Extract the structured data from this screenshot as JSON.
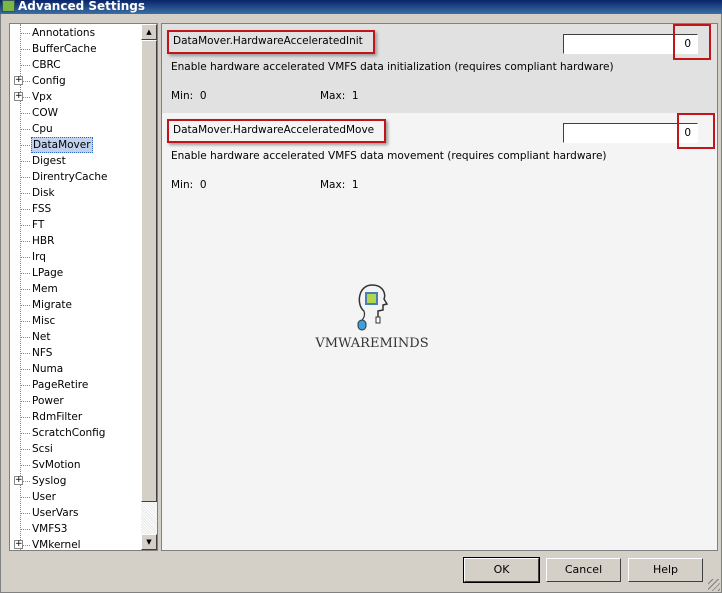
{
  "window": {
    "title": "Advanced Settings"
  },
  "tree": {
    "items": [
      {
        "label": "Annotations",
        "expandable": false
      },
      {
        "label": "BufferCache",
        "expandable": false
      },
      {
        "label": "CBRC",
        "expandable": false
      },
      {
        "label": "Config",
        "expandable": true
      },
      {
        "label": "Vpx",
        "expandable": true
      },
      {
        "label": "COW",
        "expandable": false
      },
      {
        "label": "Cpu",
        "expandable": false
      },
      {
        "label": "DataMover",
        "expandable": false,
        "selected": true
      },
      {
        "label": "Digest",
        "expandable": false
      },
      {
        "label": "DirentryCache",
        "expandable": false
      },
      {
        "label": "Disk",
        "expandable": false
      },
      {
        "label": "FSS",
        "expandable": false
      },
      {
        "label": "FT",
        "expandable": false
      },
      {
        "label": "HBR",
        "expandable": false
      },
      {
        "label": "Irq",
        "expandable": false
      },
      {
        "label": "LPage",
        "expandable": false
      },
      {
        "label": "Mem",
        "expandable": false
      },
      {
        "label": "Migrate",
        "expandable": false
      },
      {
        "label": "Misc",
        "expandable": false
      },
      {
        "label": "Net",
        "expandable": false
      },
      {
        "label": "NFS",
        "expandable": false
      },
      {
        "label": "Numa",
        "expandable": false
      },
      {
        "label": "PageRetire",
        "expandable": false
      },
      {
        "label": "Power",
        "expandable": false
      },
      {
        "label": "RdmFilter",
        "expandable": false
      },
      {
        "label": "ScratchConfig",
        "expandable": false
      },
      {
        "label": "Scsi",
        "expandable": false
      },
      {
        "label": "SvMotion",
        "expandable": false
      },
      {
        "label": "Syslog",
        "expandable": true
      },
      {
        "label": "User",
        "expandable": false
      },
      {
        "label": "UserVars",
        "expandable": false
      },
      {
        "label": "VMFS3",
        "expandable": false
      },
      {
        "label": "VMkernel",
        "expandable": true
      }
    ]
  },
  "settings": [
    {
      "name": "DataMover.HardwareAcceleratedInit",
      "value": "0",
      "description": "Enable hardware accelerated VMFS data initialization (requires compliant hardware)",
      "min_label": "Min:  0",
      "max_label": "Max:  1"
    },
    {
      "name": "DataMover.HardwareAcceleratedMove",
      "value": "0",
      "description": "Enable hardware accelerated VMFS data movement (requires compliant hardware)",
      "min_label": "Min:  0",
      "max_label": "Max:  1"
    }
  ],
  "watermark": {
    "text": "VMWAREMINDS"
  },
  "buttons": {
    "ok": "OK",
    "cancel": "Cancel",
    "help": "Help"
  },
  "colors": {
    "highlight": "#c0161b",
    "selection": "#c1d2ee"
  }
}
